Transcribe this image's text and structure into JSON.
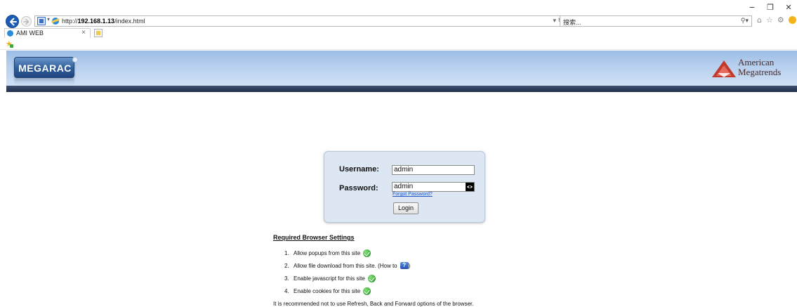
{
  "browser": {
    "url_prefix": "http://",
    "url_host": "192.168.1.13",
    "url_path": "/index.html",
    "search_placeholder": "搜索...",
    "tab_title": "AMI WEB",
    "tab_close": "×",
    "window_controls": [
      "−",
      "❐",
      "✕"
    ],
    "tool_icons": [
      "home-icon",
      "star-icon",
      "gear-icon",
      "smiley-icon"
    ]
  },
  "header": {
    "logo_text": "MEGARAC",
    "company_line1": "American",
    "company_line2": "Megatrends"
  },
  "login": {
    "username_label": "Username:",
    "username_value": "admin",
    "password_label": "Password:",
    "password_value": "admin",
    "forgot_label": "Forgot Password?",
    "login_button": "Login"
  },
  "settings": {
    "title": "Required Browser Settings",
    "items": [
      {
        "num": "1.",
        "text": "Allow popups from this site",
        "icon": "check-icon"
      },
      {
        "num": "2.",
        "text": "Allow file download from this site. (How to",
        "suffix": ")",
        "icon": "help-icon"
      },
      {
        "num": "3.",
        "text": "Enable javascript for this site",
        "icon": "check-icon"
      },
      {
        "num": "4.",
        "text": "Enable cookies for this site",
        "icon": "check-icon"
      }
    ],
    "recommendation": "It is recommended not to use Refresh, Back and Forward options of the browser."
  },
  "colors": {
    "header_gradient_top": "#9dbde5",
    "header_bar": "#1f2f4a",
    "logo_blue": "#2f5d9a",
    "login_box_bg": "#dde7f3",
    "link": "#1a4fbf",
    "ami_red": "#c0392b"
  }
}
